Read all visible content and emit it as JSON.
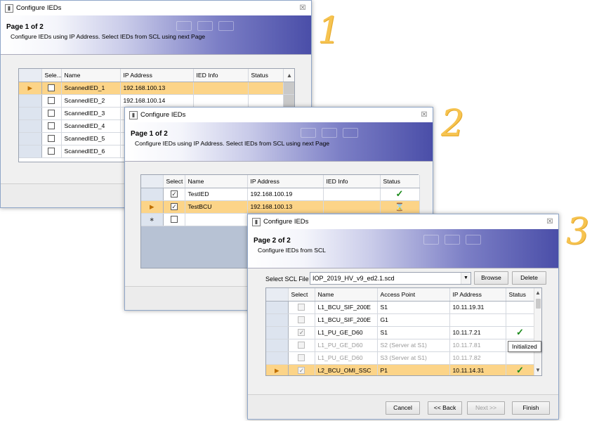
{
  "step_numbers": [
    "1",
    "2",
    "3"
  ],
  "w1": {
    "title": "Configure IEDs",
    "close": "☒",
    "page": "Page 1 of 2",
    "desc": "Configure IEDs using IP Address. Select IEDs from SCL using next Page",
    "headers": [
      "Sele...",
      "Name",
      "IP Address",
      "IED Info",
      "Status"
    ],
    "rows": [
      {
        "name": "ScannedIED_1",
        "ip": "192.168.100.13"
      },
      {
        "name": "ScannedIED_2",
        "ip": "192.168.100.14"
      },
      {
        "name": "ScannedIED_3",
        "ip": ""
      },
      {
        "name": "ScannedIED_4",
        "ip": ""
      },
      {
        "name": "ScannedIED_5",
        "ip": ""
      },
      {
        "name": "ScannedIED_6",
        "ip": ""
      }
    ]
  },
  "w2": {
    "title": "Configure IEDs",
    "close": "☒",
    "page": "Page 1 of 2",
    "desc": "Configure IEDs using IP Address. Select IEDs from SCL using next Page",
    "headers": [
      "Select",
      "Name",
      "IP Address",
      "IED Info",
      "Status"
    ],
    "rows": [
      {
        "name": "TestIED",
        "ip": "192.168.100.19",
        "status": "✓"
      },
      {
        "name": "TestBCU",
        "ip": "192.168.100.13",
        "status": "⌛"
      }
    ],
    "new_row_marker": "∗"
  },
  "w3": {
    "title": "Configure IEDs",
    "close": "☒",
    "page": "Page 2 of 2",
    "desc": "Configure IEDs from SCL",
    "scl_label": "Select SCL File",
    "scl_file": "IOP_2019_HV_v9_ed2.1.scd",
    "browse": "Browse",
    "delete": "Delete",
    "headers": [
      "Select",
      "Name",
      "Access Point",
      "IP Address",
      "Status"
    ],
    "rows": [
      {
        "name": "L1_BCU_SIF_200E",
        "ap": "S1",
        "ip": "10.11.19.31",
        "status": ""
      },
      {
        "name": "L1_BCU_SIF_200E",
        "ap": "G1",
        "ip": "",
        "status": ""
      },
      {
        "name": "L1_PU_GE_D60",
        "ap": "S1",
        "ip": "10.11.7.21",
        "status": "✓"
      },
      {
        "name": "L1_PU_GE_D60",
        "ap": "S2 (Server at S1)",
        "ip": "10.11.7.81",
        "status": ""
      },
      {
        "name": "L1_PU_GE_D60",
        "ap": "S3 (Server at S1)",
        "ip": "10.11.7.82",
        "status": ""
      },
      {
        "name": "L2_BCU_OMI_SSC",
        "ap": "P1",
        "ip": "10.11.14.31",
        "status": "✓"
      }
    ],
    "tooltip": "Initialized",
    "cancel": "Cancel",
    "back": "<< Back",
    "next": "Next >>",
    "finish": "Finish"
  }
}
